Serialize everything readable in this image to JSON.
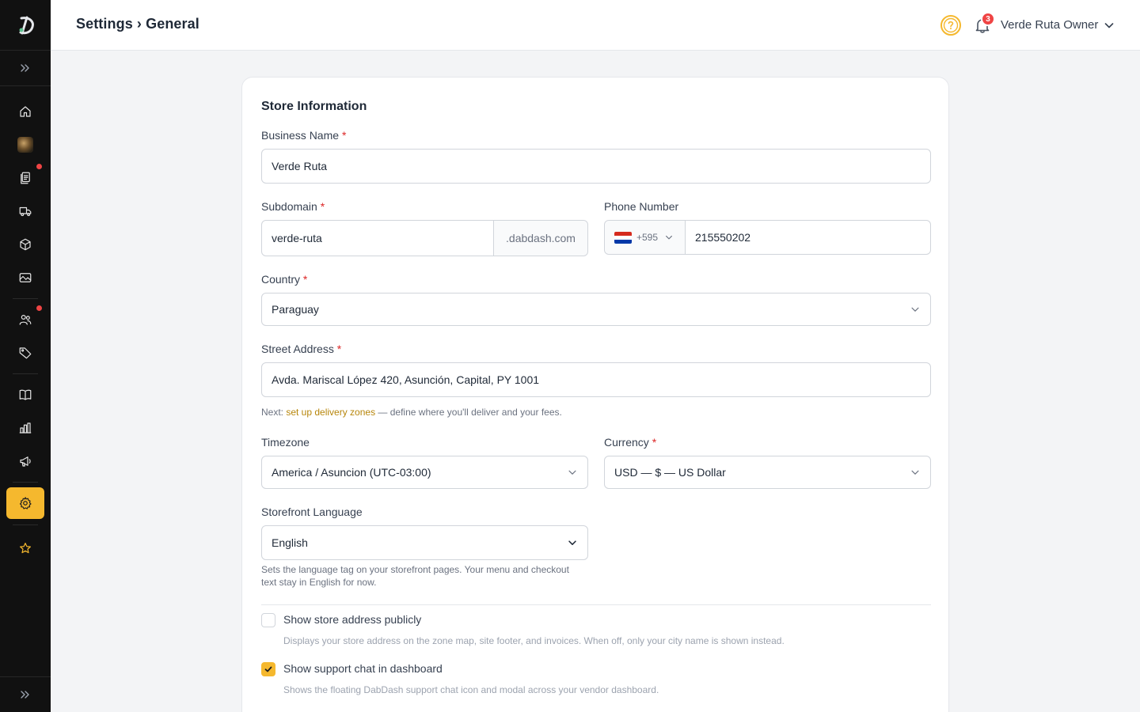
{
  "header": {
    "title": "Settings › General",
    "notification_count": "3",
    "user_name": "Verde Ruta Owner"
  },
  "sidebar": {
    "items": [
      {
        "icon": "home-icon"
      },
      {
        "icon": "product-thumbnail"
      },
      {
        "icon": "orders-icon",
        "alert": true
      },
      {
        "icon": "delivery-truck-icon"
      },
      {
        "icon": "box-icon"
      },
      {
        "icon": "image-icon"
      },
      {
        "icon": "users-icon",
        "alert": true
      },
      {
        "icon": "tag-icon"
      },
      {
        "icon": "book-icon"
      },
      {
        "icon": "analytics-icon"
      },
      {
        "icon": "megaphone-icon"
      },
      {
        "icon": "settings-icon",
        "active": true
      },
      {
        "icon": "star-icon"
      }
    ]
  },
  "form": {
    "section_title": "Store Information",
    "business_name": {
      "label": "Business Name",
      "value": "Verde Ruta"
    },
    "subdomain": {
      "label": "Subdomain",
      "value": "verde-ruta",
      "suffix": ".dabdash.com"
    },
    "phone": {
      "label": "Phone Number",
      "country_code": "+595",
      "value": "215550202"
    },
    "country": {
      "label": "Country",
      "value": "Paraguay"
    },
    "street_address": {
      "label": "Street Address",
      "value": "Avda. Mariscal López 420, Asunción, Capital, PY 1001"
    },
    "address_hint": {
      "prefix": "Next: ",
      "link": "set up delivery zones",
      "suffix": " — define where you'll deliver and your fees."
    },
    "timezone": {
      "label": "Timezone",
      "value": "America / Asuncion (UTC-03:00)"
    },
    "currency": {
      "label": "Currency",
      "value": "USD — $ — US Dollar"
    },
    "language": {
      "label": "Storefront Language",
      "value": "English",
      "hint_line1": "Sets the language tag on your storefront pages. Your menu and checkout",
      "hint_line2": "text stay in English for now."
    },
    "show_address": {
      "label": "Show store address publicly",
      "checked": false,
      "description": "Displays your store address on the zone map, site footer, and invoices. When off, only your city name is shown instead."
    },
    "support_chat": {
      "label": "Show support chat in dashboard",
      "checked": true,
      "description": "Shows the floating DabDash support chat icon and modal across your vendor dashboard."
    },
    "required_mark": "*"
  },
  "colors": {
    "accent": "#f5b82e",
    "sidebar_bg": "#111111",
    "alert": "#ef4444",
    "link": "#b7860b"
  }
}
